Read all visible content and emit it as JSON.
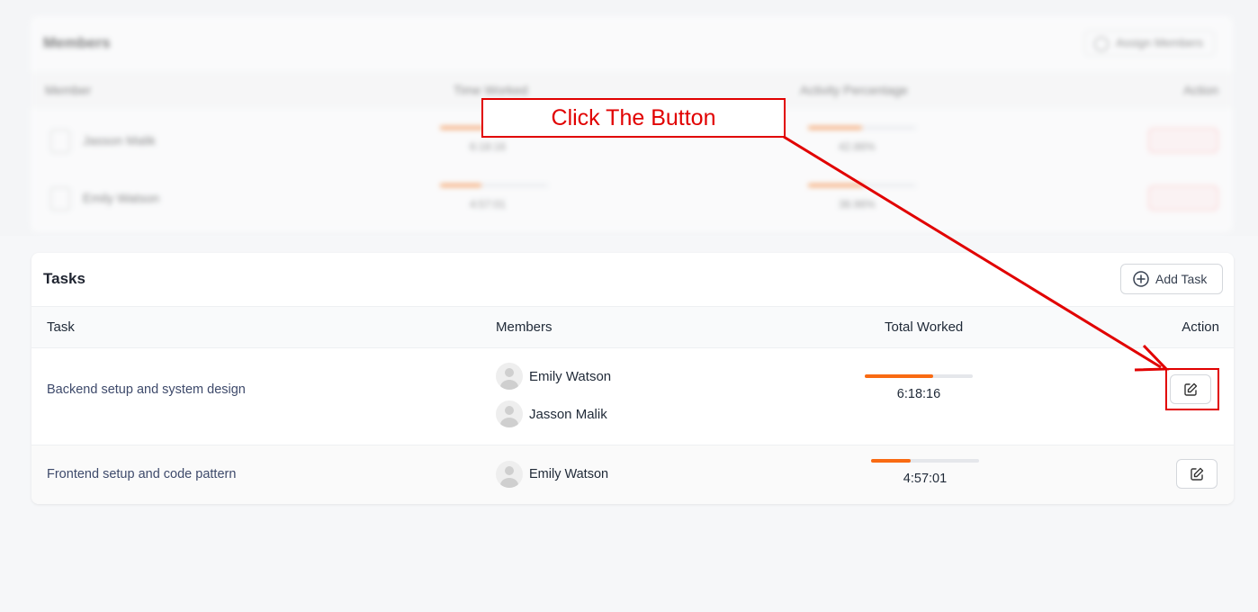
{
  "members_panel": {
    "title": "Members",
    "assign_label": "Assign Members",
    "columns": [
      "Member",
      "Time Worked",
      "Activity Percentage",
      "Action"
    ],
    "rows": [
      {
        "name": "Jasson Malik",
        "time": "6:18:16",
        "time_progress": 0.42,
        "activity": "42.86%",
        "activity_progress": 0.5,
        "action": "Unassign"
      },
      {
        "name": "Emily Watson",
        "time": "4:57:01",
        "time_progress": 0.38,
        "activity": "38.96%",
        "activity_progress": 0.52,
        "action": "Unassign"
      }
    ]
  },
  "tasks": {
    "title": "Tasks",
    "add_label": "Add Task",
    "columns": {
      "task": "Task",
      "members": "Members",
      "total": "Total Worked",
      "action": "Action"
    },
    "rows": [
      {
        "name": "Backend setup and system design",
        "members": [
          "Emily Watson",
          "Jasson Malik"
        ],
        "time": "6:18:16",
        "progress": 0.63
      },
      {
        "name": "Frontend setup and code pattern",
        "members": [
          "Emily Watson"
        ],
        "time": "4:57:01",
        "progress": 0.37
      }
    ]
  },
  "annotation": {
    "text": "Click The Button",
    "color": "#e10000"
  },
  "colors": {
    "accent": "#f96a12",
    "annotation": "#e10000"
  }
}
